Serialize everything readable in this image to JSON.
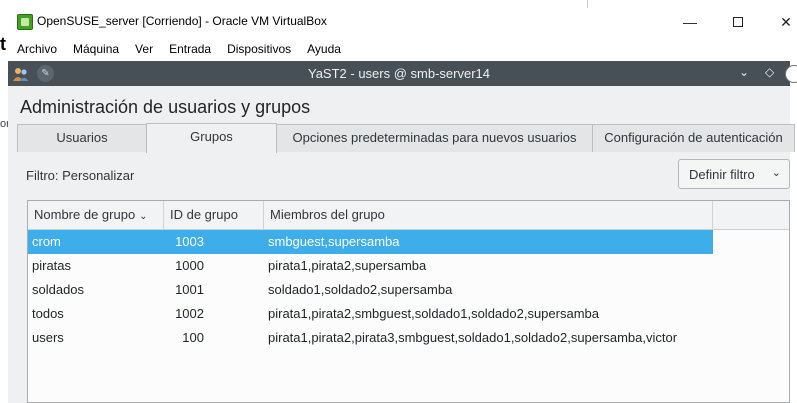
{
  "host_window": {
    "title": "OpenSUSE_server [Corriendo] - Oracle VM VirtualBox",
    "buttons": {
      "minimize": "—",
      "close": "✕"
    }
  },
  "background_text": {
    "left_glyph": "t",
    "left_fragment": "or"
  },
  "menubar": {
    "items": [
      "Archivo",
      "Máquina",
      "Ver",
      "Entrada",
      "Dispositivos",
      "Ayuda"
    ]
  },
  "guest_window": {
    "title": "YaST2 - users @ smb-server14"
  },
  "yast": {
    "heading": "Administración de usuarios y grupos",
    "tabs": [
      {
        "label": "Usuarios",
        "active": false
      },
      {
        "label": "Grupos",
        "active": true
      },
      {
        "label": "Opciones predeterminadas para nuevos usuarios",
        "active": false
      },
      {
        "label": "Configuración de autenticación",
        "active": false
      }
    ],
    "filter_label": "Filtro: Personalizar",
    "filter_button": "Definir filtro",
    "table": {
      "columns": [
        "Nombre de grupo",
        "ID de grupo",
        "Miembros del grupo"
      ],
      "rows": [
        {
          "name": "crom",
          "gid": "1003",
          "members": "smbguest,supersamba",
          "selected": true
        },
        {
          "name": "piratas",
          "gid": "1000",
          "members": "pirata1,pirata2,supersamba",
          "selected": false
        },
        {
          "name": "soldados",
          "gid": "1001",
          "members": "soldado1,soldado2,supersamba",
          "selected": false
        },
        {
          "name": "todos",
          "gid": "1002",
          "members": "pirata1,pirata2,smbguest,soldado1,soldado2,supersamba",
          "selected": false
        },
        {
          "name": "users",
          "gid": "100",
          "members": "pirata1,pirata2,pirata3,smbguest,soldado1,soldado2,supersamba,victor",
          "selected": false
        }
      ]
    }
  },
  "colors": {
    "selection": "#3daee9",
    "kde_titlebar": "#475057",
    "content_bg": "#eff0f1"
  }
}
